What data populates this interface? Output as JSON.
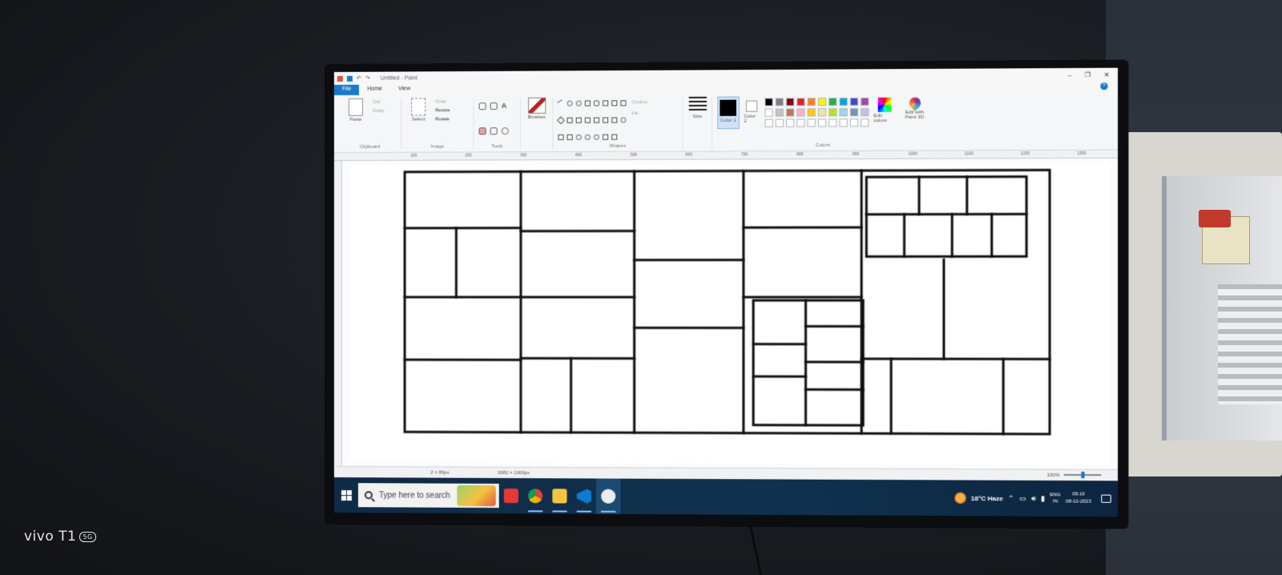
{
  "app": {
    "title": "Untitled - Paint",
    "tabs": [
      "File",
      "Home",
      "View"
    ]
  },
  "ribbon": {
    "clipboard": {
      "paste": "Paste",
      "cut": "Cut",
      "copy": "Copy",
      "group": "Clipboard"
    },
    "image": {
      "select": "Select",
      "crop": "Crop",
      "resize": "Resize",
      "rotate": "Rotate",
      "group": "Image"
    },
    "tools": {
      "group": "Tools"
    },
    "brushes": "Brushes",
    "shapes": {
      "group": "Shapes",
      "outline": "Outline",
      "fill": "Fill"
    },
    "size": "Size",
    "color1": "Color 1",
    "color2": "Color 2",
    "colors_group": "Colors",
    "edit_colors": "Edit colors",
    "edit_paint3d": "Edit with Paint 3D",
    "palette": [
      "#000000",
      "#7f7f7f",
      "#880015",
      "#ed1c24",
      "#ff7f27",
      "#fff200",
      "#22b14c",
      "#00a2e8",
      "#3f48cc",
      "#a349a4",
      "#ffffff",
      "#c3c3c3",
      "#b97a57",
      "#ffaec9",
      "#ffc90e",
      "#efe4b0",
      "#b5e61d",
      "#99d9ea",
      "#7092be",
      "#c8bfe7",
      "#ffffff",
      "#ffffff",
      "#ffffff",
      "#ffffff",
      "#ffffff",
      "#ffffff",
      "#ffffff",
      "#ffffff",
      "#ffffff",
      "#ffffff"
    ]
  },
  "ruler": [
    "100",
    "200",
    "300",
    "400",
    "500",
    "600",
    "700",
    "800",
    "900",
    "1000",
    "1100",
    "1200",
    "1300"
  ],
  "status": {
    "selection": "2 × 86px",
    "canvas_size": "2682 × 1006px",
    "zoom": "100%"
  },
  "taskbar": {
    "search_placeholder": "Type here to search",
    "weather": "18°C Haze",
    "lang_top": "ENG",
    "lang_bottom": "IN",
    "time": "09:19",
    "date": "08-12-2023"
  },
  "watermark": {
    "brand": "vivo T1",
    "badge": "5G"
  },
  "colors": {
    "accent": "#1979ca",
    "taskbar": "#10324f"
  }
}
